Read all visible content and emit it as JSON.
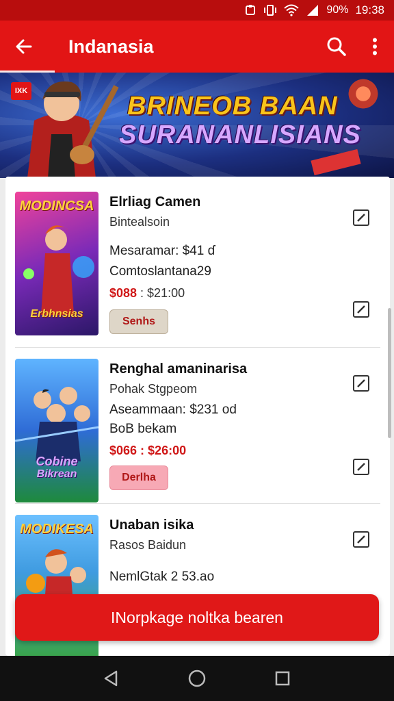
{
  "status": {
    "battery": "90%",
    "time": "19:38"
  },
  "appbar": {
    "title": "Indanasia"
  },
  "banner": {
    "badge": "IXK",
    "line1": "BRINEOB BAAN",
    "line2": "SURANANLISIANS"
  },
  "items": [
    {
      "cover_text": "MODINCSA",
      "cover_sub": "Erbhnsias",
      "title": "Elrliag Camen",
      "subtitle": "Bintealsoin",
      "line3": "Mesaramar: $41 ɗ",
      "line4": "Comtoslantana29",
      "price_red": "$088",
      "price_rest": " : $21:00",
      "button": "Senhs"
    },
    {
      "cover_text": "Cobine",
      "cover_sub": "Bikrean",
      "title": "Renghal amaninarisa",
      "subtitle": "Pohak Stgpeom",
      "line3": "Aseammaan: $231 od",
      "line4": "BoB bekam",
      "price_red": "$066",
      "price_rest": " : $26:00",
      "button": "Derlha"
    },
    {
      "cover_text": "MODIKESA",
      "title": "Unaban isika",
      "subtitle": "Rasos Baidun",
      "line3": "NemlGtak 2 53.ao"
    }
  ],
  "cta": {
    "label": "INorpkage noltka bearen"
  },
  "colors": {
    "primary": "#e21515",
    "statusbar": "#b80d0d",
    "price": "#d01818"
  }
}
